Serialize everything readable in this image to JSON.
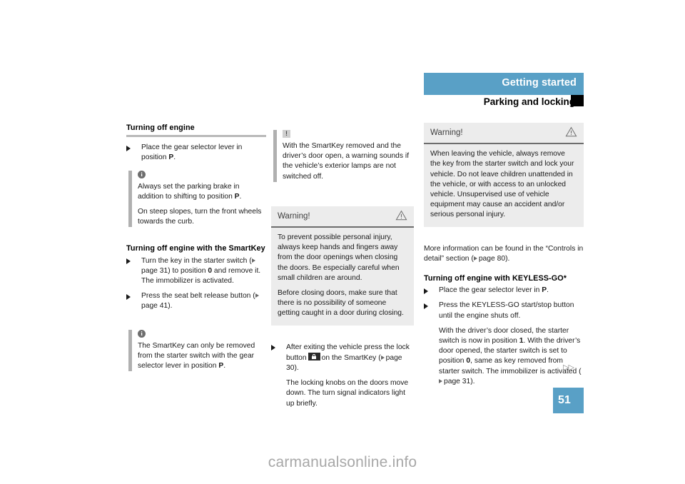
{
  "header": {
    "chapter_title": "Getting started",
    "section_title": "Parking and locking",
    "marker": "section-marker"
  },
  "page_number": "51",
  "watermark": "carmanualsonline.info",
  "continuation": "▷▷",
  "column1": {
    "heading1": "Turning off engine",
    "bullet1": "Place the gear selector lever in position",
    "bullet1_bold": "P",
    "bullet1_end": ".",
    "note1": {
      "icon": "info-icon",
      "para1_a": "Always set the parking brake in addition to shifting to position ",
      "para1_bold": "P",
      "para1_b": ".",
      "para2": "On steep slopes, turn the front wheels towards the curb."
    },
    "heading2": "Turning off engine with the SmartKey",
    "bullet2_a": "Turn the key in the starter switch (",
    "bullet2_xref": "page 31",
    "bullet2_b": ") to position ",
    "bullet2_bold": "0",
    "bullet2_c": " and remove it.",
    "bullet2_d": "The immobilizer is activated.",
    "bullet3_a": "Press the seat belt release button (",
    "bullet3_xref": "page 41",
    "bullet3_b": ").",
    "note2": {
      "icon": "info-icon",
      "para1_a": "The SmartKey can only be removed from the starter switch with the gear selector lever in position ",
      "para1_bold": "P",
      "para1_b": "."
    }
  },
  "column2": {
    "note1": {
      "icon": "exclamation-icon",
      "para1": "With the SmartKey removed and the driver’s door open, a warning sounds if the vehicle’s exterior lamps are not switched off."
    },
    "warning": {
      "title": "Warning!",
      "icon": "warning-triangle-icon",
      "para1": "To prevent possible personal injury, always keep hands and fingers away from the door openings when closing the doors. Be especially careful when small children are around.",
      "para2": "Before closing doors, make sure that there is no possibility of someone getting caught in a door during closing."
    },
    "bullet1_a": "After exiting the vehicle press the lock button",
    "bullet1_icon": "lock-button-icon",
    "bullet1_b": "on the SmartKey (",
    "bullet1_xref": "page 30",
    "bullet1_c": ").",
    "bullet1_d": "The locking knobs on the doors move down. The turn signal indicators light up briefly."
  },
  "column3": {
    "warning": {
      "title": "Warning!",
      "icon": "warning-triangle-icon",
      "para1": "When leaving the vehicle, always remove the key from the starter switch and lock your vehicle. Do not leave children unattended in the vehicle, or with access to an unlocked vehicle. Unsupervised use of vehicle equipment may cause an accident and/or serious personal injury."
    },
    "para_more_a": "More information can be found in the “Controls in detail” section (",
    "para_more_xref": "page 80",
    "para_more_b": ").",
    "heading1": "Turning off engine with KEYLESS-GO*",
    "bullet1_a": "Place the gear selector lever in ",
    "bullet1_bold": "P",
    "bullet1_b": ".",
    "bullet2": "Press the KEYLESS-GO start/stop button until the engine shuts off.",
    "bullet2_body_a": "With the driver’s door closed, the starter switch is now in position ",
    "bullet2_body_bold1": "1",
    "bullet2_body_b": ". With the driver’s door opened, the starter switch is set to position ",
    "bullet2_body_bold2": "0",
    "bullet2_body_c": ", same as key removed from starter switch. The immobilizer is activated (",
    "bullet2_xref": "page 31",
    "bullet2_body_d": ")."
  },
  "colors": {
    "accent_blue": "#59a0c6",
    "rule_gray": "#b9b9b9",
    "note_bar_gray": "#b0b0b0",
    "warnbox_bg": "#ececec"
  }
}
